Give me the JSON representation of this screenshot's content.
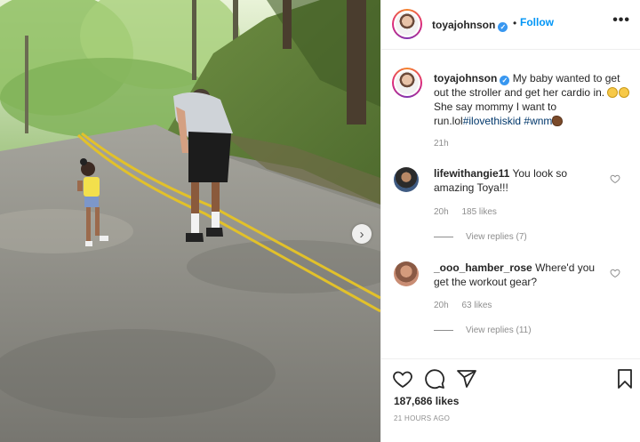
{
  "post": {
    "username": "toyajohnson",
    "follow_label": "Follow",
    "separator": "•",
    "more_label": "•••",
    "next_label": "›",
    "caption": {
      "username": "toyajohnson",
      "text": "My baby wanted to get out the stroller and get her cardio in.",
      "text2": "She say mommy I want to run.lol",
      "hashtags": [
        "#ilovethiskid",
        "#wnm"
      ],
      "time": "21h"
    },
    "comments": [
      {
        "username": "lifewithangie11",
        "text": "You look so amazing Toya!!!",
        "time": "20h",
        "likes": "185 likes",
        "replies": "View replies (7)"
      },
      {
        "username": "_ooo_hamber_rose",
        "text": "Where'd you get the workout gear?",
        "time": "20h",
        "likes": "63 likes",
        "replies": "View replies (11)"
      }
    ],
    "likes_count": "187,686 likes",
    "timestamp": "21 HOURS AGO"
  },
  "icons": {
    "verified": "verified-badge-icon",
    "like": "heart-icon",
    "comment": "comment-bubble-icon",
    "share": "paper-plane-icon",
    "save": "bookmark-icon",
    "next": "chevron-right-icon"
  },
  "colors": {
    "follow": "#0095f6",
    "verified": "#3897f0",
    "muted": "#8e8e8e",
    "hashtag": "#00376b",
    "text": "#262626"
  }
}
